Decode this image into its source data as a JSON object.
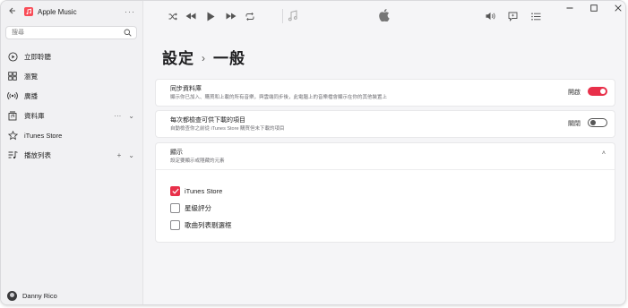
{
  "app": {
    "title": "Apple Music",
    "more_label": "···"
  },
  "search": {
    "placeholder": "搜尋"
  },
  "sidebar": {
    "items": [
      {
        "label": "立即聆聽",
        "icon": "play-circle-icon"
      },
      {
        "label": "瀏覽",
        "icon": "grid-icon"
      },
      {
        "label": "廣播",
        "icon": "radio-icon"
      },
      {
        "label": "資料庫",
        "icon": "library-icon",
        "trail": [
          "···",
          "⌄"
        ]
      },
      {
        "label": "iTunes Store",
        "icon": "star-icon"
      },
      {
        "label": "播放列表",
        "icon": "playlist-icon",
        "trail": [
          "+",
          "⌄"
        ]
      }
    ]
  },
  "user": {
    "name": "Danny Rico"
  },
  "page": {
    "breadcrumb_parent": "設定",
    "breadcrumb_current": "一般"
  },
  "settings": {
    "sync": {
      "title": "同步資料庫",
      "subtitle": "顯示你已加入、購買和上載的所有音樂，與雲端同步後，此電腦上的音樂檔會顯示在你的其他裝置上",
      "state_label": "開啟",
      "on": true
    },
    "auto_check": {
      "title": "每次都檢查可供下載的項目",
      "subtitle": "自動檢查你之前從 iTunes Store 購買但未下載的項目",
      "state_label": "關閉",
      "on": false
    },
    "display": {
      "title": "顯示",
      "subtitle": "設定要顯示或隱藏的元素",
      "expand_glyph": "˄",
      "options": [
        {
          "label": "iTunes Store",
          "checked": true
        },
        {
          "label": "星級評分",
          "checked": false
        },
        {
          "label": "歌曲列表剔選框",
          "checked": false
        }
      ]
    }
  },
  "colors": {
    "accent": "#e8304a",
    "app_icon": "#f94c57"
  }
}
